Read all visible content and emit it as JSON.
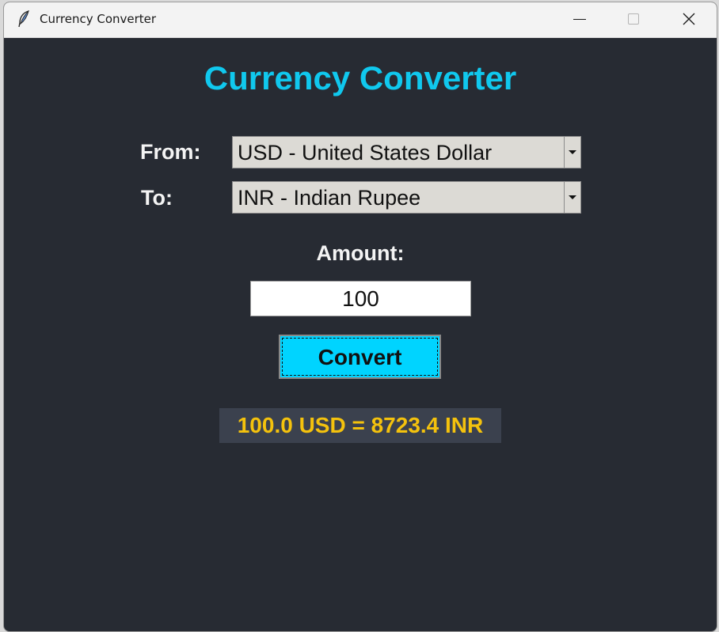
{
  "window": {
    "title": "Currency Converter",
    "icon": "feather-icon"
  },
  "controls": {
    "minimize": "minimize-icon",
    "maximize": "maximize-icon",
    "close": "close-icon"
  },
  "app": {
    "heading": "Currency Converter",
    "from_label": "From:",
    "to_label": "To:",
    "from_value": "USD - United States Dollar",
    "to_value": "INR - Indian Rupee",
    "amount_label": "Amount:",
    "amount_value": "100",
    "convert_label": "Convert",
    "result": "100.0 USD = 8723.4 INR"
  },
  "colors": {
    "background": "#272b33",
    "heading": "#10c8ee",
    "button": "#00d4ff",
    "result_text": "#f4c20d",
    "result_background": "#3b414e"
  }
}
